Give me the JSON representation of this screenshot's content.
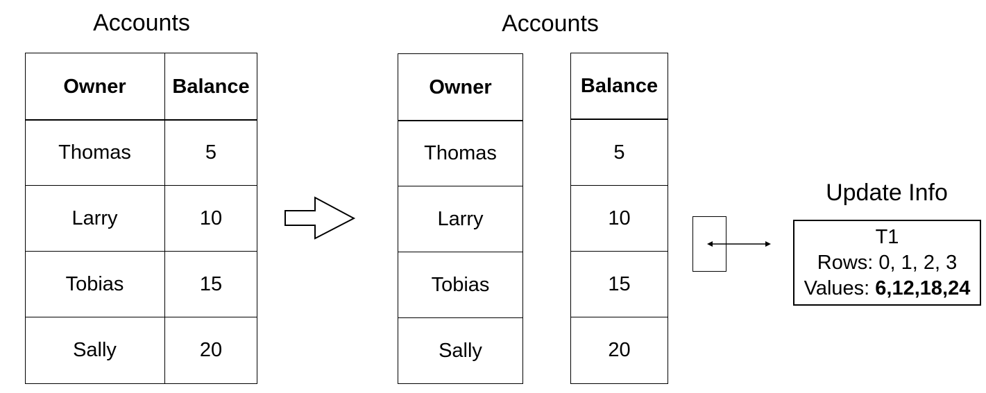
{
  "left_table": {
    "title": "Accounts",
    "headers": [
      "Owner",
      "Balance"
    ],
    "rows": [
      {
        "owner": "Thomas",
        "balance": "5"
      },
      {
        "owner": "Larry",
        "balance": "10"
      },
      {
        "owner": "Tobias",
        "balance": "15"
      },
      {
        "owner": "Sally",
        "balance": "20"
      }
    ]
  },
  "right_table": {
    "title": "Accounts",
    "headers": [
      "Owner",
      "Balance"
    ],
    "rows": [
      {
        "owner": "Thomas",
        "balance": "5"
      },
      {
        "owner": "Larry",
        "balance": "10"
      },
      {
        "owner": "Tobias",
        "balance": "15"
      },
      {
        "owner": "Sally",
        "balance": "20"
      }
    ]
  },
  "transition_arrow": {
    "icon": "block-arrow-right-icon"
  },
  "link": {
    "icon": "double-headed-arrow-icon"
  },
  "update_info": {
    "title": "Update Info",
    "transaction": "T1",
    "rows_label": "Rows: 0, 1, 2, 3",
    "values_prefix": "Values: ",
    "values": "6,12,18,24"
  }
}
